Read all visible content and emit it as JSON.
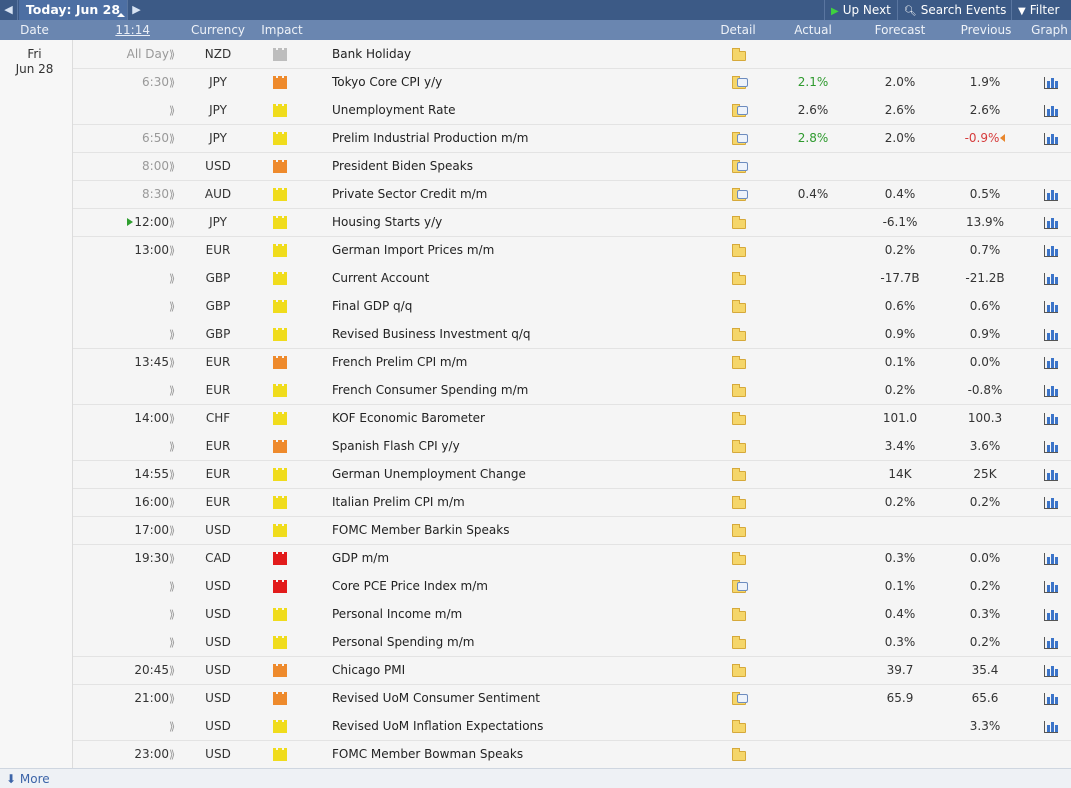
{
  "toolbar": {
    "today_label": "Today: Jun 28",
    "up_next_label": "Up Next",
    "search_label": "Search Events",
    "filter_label": "Filter"
  },
  "header": {
    "date": "Date",
    "time": "11:14",
    "currency": "Currency",
    "impact": "Impact",
    "detail": "Detail",
    "actual": "Actual",
    "forecast": "Forecast",
    "previous": "Previous",
    "graph": "Graph"
  },
  "day": {
    "name": "Fri",
    "date": "Jun 28"
  },
  "colors": {
    "high": "#e21b1b",
    "medium": "#ee8a2c",
    "low": "#f0dc1c",
    "holiday": "#bdbdbd",
    "better": "#2e9a2e",
    "worse": "#d63b3b"
  },
  "rows": [
    {
      "time": "All Day",
      "currency": "NZD",
      "impact": "grey",
      "event": "Bank Holiday",
      "detail_icon": "folder-icon",
      "actual": "",
      "forecast": "",
      "previous": "",
      "graph": false
    },
    {
      "time": "6:30",
      "currency": "JPY",
      "impact": "orange",
      "event": "Tokyo Core CPI y/y",
      "detail_icon": "folder-report-icon",
      "actual": "2.1%",
      "actual_color": "green",
      "forecast": "2.0%",
      "previous": "1.9%",
      "graph": true
    },
    {
      "time": "",
      "currency": "JPY",
      "impact": "yellow",
      "event": "Unemployment Rate",
      "detail_icon": "folder-report-icon",
      "actual": "2.6%",
      "forecast": "2.6%",
      "previous": "2.6%",
      "graph": true
    },
    {
      "time": "6:50",
      "currency": "JPY",
      "impact": "yellow",
      "event": "Prelim Industrial Production m/m",
      "detail_icon": "folder-report-icon",
      "actual": "2.8%",
      "actual_color": "green",
      "forecast": "2.0%",
      "previous": "-0.9%",
      "previous_color": "red",
      "revised": true,
      "graph": true
    },
    {
      "time": "8:00",
      "currency": "USD",
      "impact": "orange",
      "event": "President Biden Speaks",
      "detail_icon": "folder-report-icon",
      "actual": "",
      "forecast": "",
      "previous": "",
      "graph": false
    },
    {
      "time": "8:30",
      "currency": "AUD",
      "impact": "yellow",
      "event": "Private Sector Credit m/m",
      "detail_icon": "folder-report-icon",
      "actual": "0.4%",
      "forecast": "0.4%",
      "previous": "0.5%",
      "graph": true
    },
    {
      "time": "12:00",
      "currency": "JPY",
      "impact": "yellow",
      "event": "Housing Starts y/y",
      "detail_icon": "folder-icon",
      "actual": "",
      "forecast": "-6.1%",
      "previous": "13.9%",
      "graph": true,
      "next": true
    },
    {
      "time": "13:00",
      "currency": "EUR",
      "impact": "yellow",
      "event": "German Import Prices m/m",
      "detail_icon": "folder-icon",
      "actual": "",
      "forecast": "0.2%",
      "previous": "0.7%",
      "graph": true
    },
    {
      "time": "",
      "currency": "GBP",
      "impact": "yellow",
      "event": "Current Account",
      "detail_icon": "folder-icon",
      "actual": "",
      "forecast": "-17.7B",
      "previous": "-21.2B",
      "graph": true
    },
    {
      "time": "",
      "currency": "GBP",
      "impact": "yellow",
      "event": "Final GDP q/q",
      "detail_icon": "folder-icon",
      "actual": "",
      "forecast": "0.6%",
      "previous": "0.6%",
      "graph": true
    },
    {
      "time": "",
      "currency": "GBP",
      "impact": "yellow",
      "event": "Revised Business Investment q/q",
      "detail_icon": "folder-icon",
      "actual": "",
      "forecast": "0.9%",
      "previous": "0.9%",
      "graph": true
    },
    {
      "time": "13:45",
      "currency": "EUR",
      "impact": "orange",
      "event": "French Prelim CPI m/m",
      "detail_icon": "folder-icon",
      "actual": "",
      "forecast": "0.1%",
      "previous": "0.0%",
      "graph": true
    },
    {
      "time": "",
      "currency": "EUR",
      "impact": "yellow",
      "event": "French Consumer Spending m/m",
      "detail_icon": "folder-icon",
      "actual": "",
      "forecast": "0.2%",
      "previous": "-0.8%",
      "graph": true
    },
    {
      "time": "14:00",
      "currency": "CHF",
      "impact": "yellow",
      "event": "KOF Economic Barometer",
      "detail_icon": "folder-icon",
      "actual": "",
      "forecast": "101.0",
      "previous": "100.3",
      "graph": true
    },
    {
      "time": "",
      "currency": "EUR",
      "impact": "orange",
      "event": "Spanish Flash CPI y/y",
      "detail_icon": "folder-icon",
      "actual": "",
      "forecast": "3.4%",
      "previous": "3.6%",
      "graph": true
    },
    {
      "time": "14:55",
      "currency": "EUR",
      "impact": "yellow",
      "event": "German Unemployment Change",
      "detail_icon": "folder-icon",
      "actual": "",
      "forecast": "14K",
      "previous": "25K",
      "graph": true
    },
    {
      "time": "16:00",
      "currency": "EUR",
      "impact": "yellow",
      "event": "Italian Prelim CPI m/m",
      "detail_icon": "folder-icon",
      "actual": "",
      "forecast": "0.2%",
      "previous": "0.2%",
      "graph": true
    },
    {
      "time": "17:00",
      "currency": "USD",
      "impact": "yellow",
      "event": "FOMC Member Barkin Speaks",
      "detail_icon": "folder-icon",
      "actual": "",
      "forecast": "",
      "previous": "",
      "graph": false
    },
    {
      "time": "19:30",
      "currency": "CAD",
      "impact": "red",
      "event": "GDP m/m",
      "detail_icon": "folder-icon",
      "actual": "",
      "forecast": "0.3%",
      "previous": "0.0%",
      "graph": true
    },
    {
      "time": "",
      "currency": "USD",
      "impact": "red",
      "event": "Core PCE Price Index m/m",
      "detail_icon": "folder-report-icon",
      "actual": "",
      "forecast": "0.1%",
      "previous": "0.2%",
      "graph": true
    },
    {
      "time": "",
      "currency": "USD",
      "impact": "yellow",
      "event": "Personal Income m/m",
      "detail_icon": "folder-icon",
      "actual": "",
      "forecast": "0.4%",
      "previous": "0.3%",
      "graph": true
    },
    {
      "time": "",
      "currency": "USD",
      "impact": "yellow",
      "event": "Personal Spending m/m",
      "detail_icon": "folder-icon",
      "actual": "",
      "forecast": "0.3%",
      "previous": "0.2%",
      "graph": true
    },
    {
      "time": "20:45",
      "currency": "USD",
      "impact": "orange",
      "event": "Chicago PMI",
      "detail_icon": "folder-icon",
      "actual": "",
      "forecast": "39.7",
      "previous": "35.4",
      "graph": true
    },
    {
      "time": "21:00",
      "currency": "USD",
      "impact": "orange",
      "event": "Revised UoM Consumer Sentiment",
      "detail_icon": "folder-report-icon",
      "actual": "",
      "forecast": "65.9",
      "previous": "65.6",
      "graph": true
    },
    {
      "time": "",
      "currency": "USD",
      "impact": "yellow",
      "event": "Revised UoM Inflation Expectations",
      "detail_icon": "folder-icon",
      "actual": "",
      "forecast": "",
      "previous": "3.3%",
      "graph": true
    },
    {
      "time": "23:00",
      "currency": "USD",
      "impact": "yellow",
      "event": "FOMC Member Bowman Speaks",
      "detail_icon": "folder-icon",
      "actual": "",
      "forecast": "",
      "previous": "",
      "graph": false
    }
  ],
  "footer": {
    "more_label": "More"
  }
}
